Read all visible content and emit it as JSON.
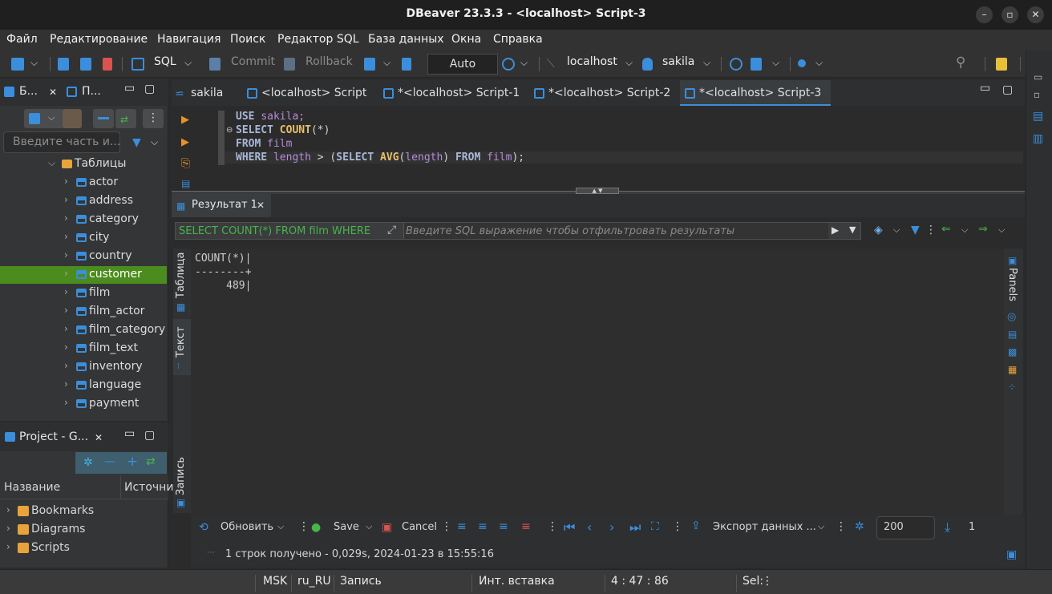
{
  "window": {
    "title": "DBeaver 23.3.3 - <localhost> Script-3"
  },
  "menu": [
    "Файл",
    "Редактирование",
    "Навигация",
    "Поиск",
    "Редактор SQL",
    "База данных",
    "Окна",
    "Справка"
  ],
  "toolbar": {
    "sql_label": "SQL",
    "commit_label": "Commit",
    "rollback_label": "Rollback",
    "mode_label": "Auto",
    "connection_label": "localhost",
    "database_label": "sakila"
  },
  "navigator": {
    "tab1": "Б...",
    "tab2": "П...",
    "filter_placeholder": "Введите часть и...",
    "folder_label": "Таблицы",
    "tables": [
      "actor",
      "address",
      "category",
      "city",
      "country",
      "customer",
      "film",
      "film_actor",
      "film_category",
      "film_text",
      "inventory",
      "language",
      "payment"
    ],
    "selected_table": "customer"
  },
  "project": {
    "tab_label": "Project - G...",
    "col_name": "Название",
    "col_source": "Источни",
    "items": [
      "Bookmarks",
      "Diagrams",
      "Scripts"
    ]
  },
  "editor": {
    "tabs": [
      "sakila",
      "<localhost> Script",
      "*<localhost> Script-1",
      "*<localhost> Script-2",
      "*<localhost> Script-3"
    ],
    "active_tab": "*<localhost> Script-3",
    "line1_kw": "USE",
    "line1_id": "sakila;",
    "line2_kw": "SELECT",
    "line2_fn": "COUNT",
    "line2_rest": "(*)",
    "line3_kw": "FROM",
    "line3_id": "film",
    "line4_kw": "WHERE",
    "line4_id1": "length",
    "line4_op": " > (",
    "line4_kw2": "SELECT",
    "line4_fn": "AVG",
    "line4_p1": "(",
    "line4_id2": "length",
    "line4_p2": ") ",
    "line4_kw3": "FROM",
    "line4_id3": "film",
    "line4_end": ");"
  },
  "results": {
    "tab_label": "Результат 1",
    "query_preview": "SELECT COUNT(*) FROM film WHERE",
    "filter_placeholder": "Введите SQL выражение чтобы отфильтровать результаты",
    "vtab_table": "Таблица",
    "vtab_text": "Текст",
    "vtab_record": "Запись",
    "panels_label": "Panels",
    "text_output": "COUNT(*)|\n--------+\n     489|",
    "refresh_label": "Обновить",
    "save_label": "Save",
    "cancel_label": "Cancel",
    "export_label": "Экспорт данных ...",
    "fetch_size": "200",
    "count_label": "1",
    "status_text": "1 строк получено - 0,029s, 2024-01-23 в 15:55:16"
  },
  "statusbar": {
    "tz": "MSK",
    "locale": "ru_RU",
    "mode": "Запись",
    "insert": "Инт. вставка",
    "position": "4 : 47 : 86",
    "sel": "Sel:"
  }
}
